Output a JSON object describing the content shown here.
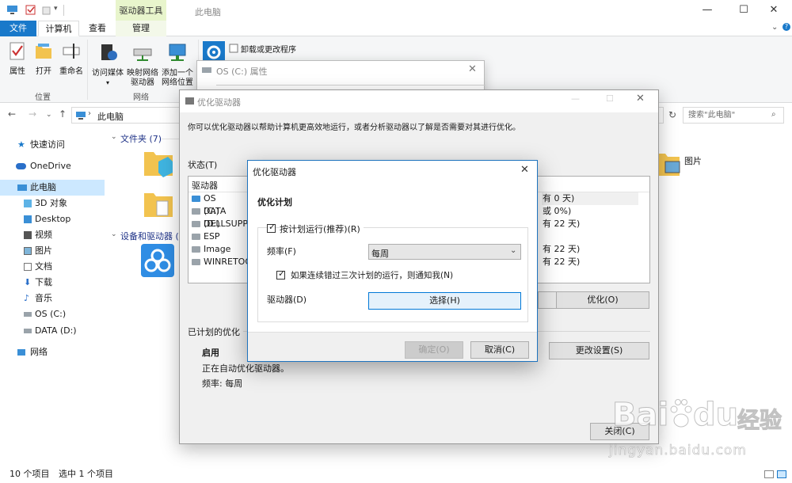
{
  "titlebar": {
    "context_tab": "驱动器工具",
    "title": "此电脑",
    "minimize": "—",
    "maximize": "☐",
    "close": "✕"
  },
  "tabs": {
    "file": "文件",
    "computer": "计算机",
    "view": "查看",
    "manage": "管理"
  },
  "ribbon": {
    "properties": "属性",
    "open": "打开",
    "rename": "重命名",
    "group_location": "位置",
    "access_media": "访问媒体",
    "map_network_drive_1": "映射网络",
    "map_network_drive_2": "驱动器",
    "add_network_location_1": "添加一个",
    "add_network_location_2": "网络位置",
    "group_network": "网络",
    "uninstall": "卸载或更改程序"
  },
  "address": {
    "path": "此电脑",
    "search_placeholder": "搜索\"此电脑\""
  },
  "nav": {
    "items": [
      {
        "label": "快速访问"
      },
      {
        "label": "OneDrive"
      },
      {
        "label": "此电脑"
      },
      {
        "label": "3D 对象"
      },
      {
        "label": "Desktop"
      },
      {
        "label": "视频"
      },
      {
        "label": "图片"
      },
      {
        "label": "文档"
      },
      {
        "label": "下载"
      },
      {
        "label": "音乐"
      },
      {
        "label": "OS (C:)"
      },
      {
        "label": "DATA (D:)"
      },
      {
        "label": "网络"
      }
    ]
  },
  "content": {
    "folders_group": "文件夹 (7)",
    "devices_group": "设备和驱动器 (3)",
    "pictures": "图片"
  },
  "statusbar": {
    "count": "10 个项目",
    "selected": "选中 1 个项目"
  },
  "props_window": {
    "title": "OS (C:) 属性"
  },
  "optimize_window": {
    "title": "优化驱动器",
    "description": "你可以优化驱动器以帮助计算机更高效地运行，或者分析驱动器以了解是否需要对其进行优化。",
    "status_label": "状态(T)",
    "col_drive": "驱动器",
    "drives": [
      {
        "name": "OS (C:)",
        "status": "有 0 天)"
      },
      {
        "name": "DATA (D:)",
        "status": "或 0%)"
      },
      {
        "name": "DELLSUPPO",
        "status": "有 22 天)"
      },
      {
        "name": "ESP",
        "status": ""
      },
      {
        "name": "Image",
        "status": "有 22 天)"
      },
      {
        "name": "WINRETOO",
        "status": "有 22 天)"
      }
    ],
    "optimize_button": "优化(O)",
    "scheduled_label": "已计划的优化",
    "scheduled_state": "启用",
    "scheduled_desc": "正在自动优化驱动器。",
    "frequency_line": "频率: 每周",
    "change_settings": "更改设置(S)",
    "close_button": "关闭(C)"
  },
  "modal": {
    "title": "优化驱动器",
    "heading": "优化计划",
    "run_on_schedule": "按计划运行(推荐)(R)",
    "frequency_label": "频率(F)",
    "frequency_value": "每周",
    "notify_missed": "如果连续错过三次计划的运行，则通知我(N)",
    "drives_label": "驱动器(D)",
    "choose_button": "选择(H)",
    "ok_button": "确定(O)",
    "cancel_button": "取消(C)"
  },
  "watermark": {
    "brand": "Bai",
    "brand2": "du",
    "cn": "经验",
    "url": "jingyan.baidu.com"
  },
  "colors": {
    "accent": "#1979ca",
    "context_tab": "#e8f5cc",
    "nav_selected": "#cce8ff",
    "modal_border": "#1e73be"
  }
}
